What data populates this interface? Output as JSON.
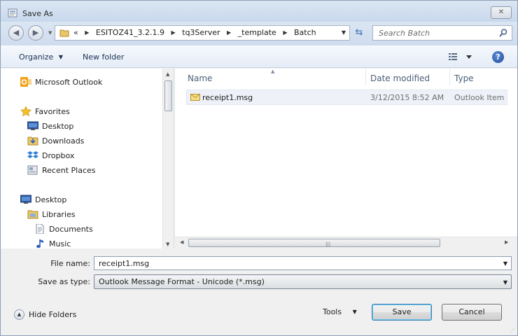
{
  "window": {
    "title": "Save As",
    "close_label": "✕"
  },
  "address": {
    "overflow": "«",
    "crumbs": [
      "ESITOZ41_3.2.1.9",
      "tq3Server",
      "_template",
      "Batch"
    ]
  },
  "search": {
    "placeholder": "Search Batch"
  },
  "toolbar": {
    "organize": "Organize",
    "new_folder": "New folder",
    "help": "?"
  },
  "nav": {
    "items": [
      {
        "label": "Microsoft Outlook",
        "icon": "outlook-icon"
      },
      {
        "label": "Favorites",
        "icon": "star-icon"
      },
      {
        "label": "Desktop",
        "icon": "desktop-icon"
      },
      {
        "label": "Downloads",
        "icon": "downloads-icon"
      },
      {
        "label": "Dropbox",
        "icon": "dropbox-icon"
      },
      {
        "label": "Recent Places",
        "icon": "recent-places-icon"
      },
      {
        "label": "Desktop",
        "icon": "desktop-icon"
      },
      {
        "label": "Libraries",
        "icon": "libraries-icon"
      },
      {
        "label": "Documents",
        "icon": "documents-icon"
      },
      {
        "label": "Music",
        "icon": "music-icon"
      }
    ]
  },
  "files": {
    "columns": {
      "name": "Name",
      "date": "Date modified",
      "type": "Type"
    },
    "rows": [
      {
        "name": "receipt1.msg",
        "date": "3/12/2015 8:52 AM",
        "type": "Outlook Item"
      }
    ]
  },
  "form": {
    "file_name_label": "File name:",
    "file_name_value": "receipt1.msg",
    "save_type_label": "Save as type:",
    "save_type_value": "Outlook Message Format - Unicode (*.msg)"
  },
  "footer": {
    "hide_folders": "Hide Folders",
    "tools": "Tools",
    "save": "Save",
    "cancel": "Cancel"
  }
}
